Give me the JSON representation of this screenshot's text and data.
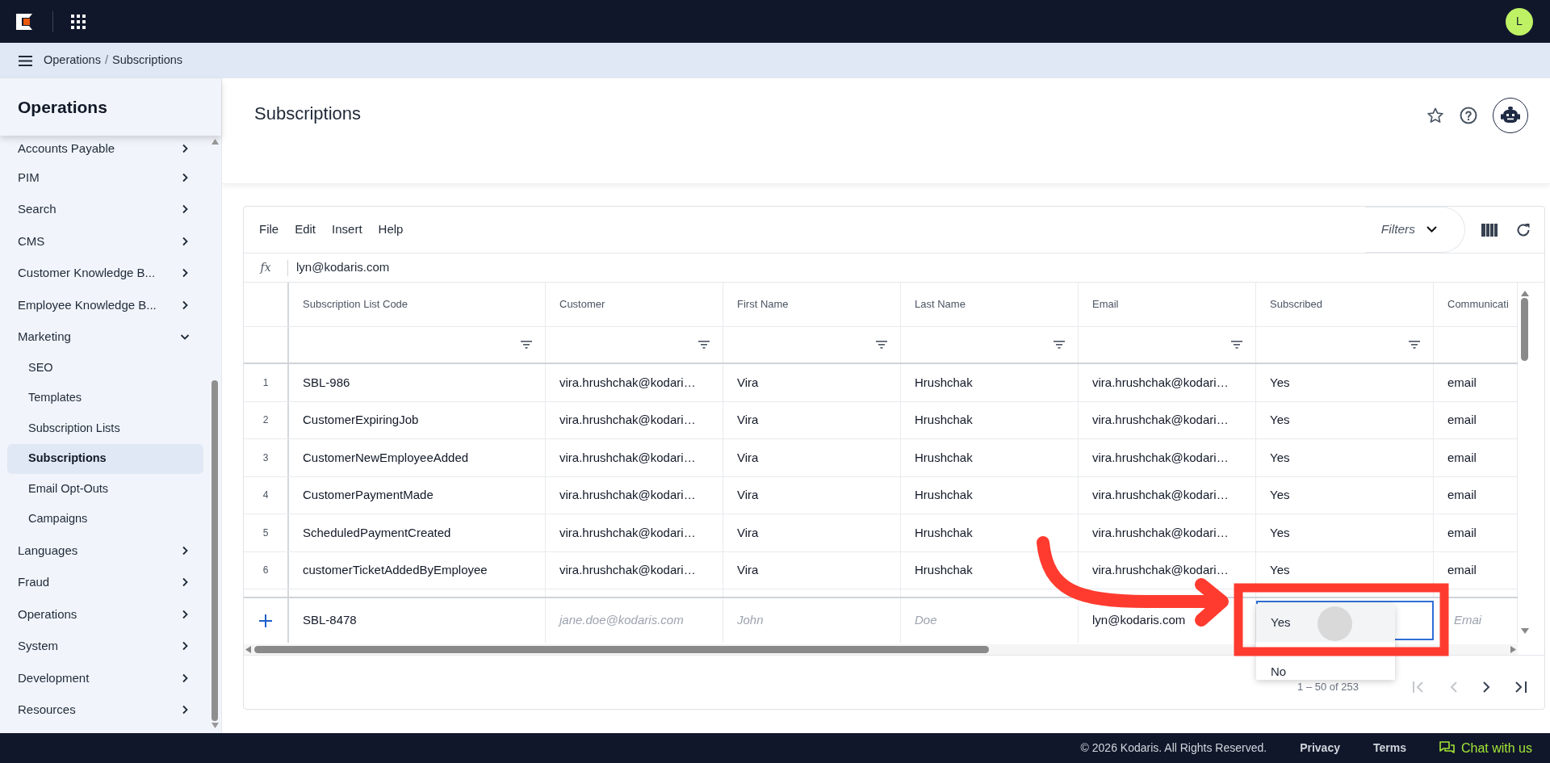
{
  "topbar": {
    "avatar": "L"
  },
  "breadcrumb": {
    "separator": "/",
    "items": [
      "Operations",
      "Subscriptions"
    ]
  },
  "sidebar": {
    "title": "Operations",
    "items": [
      {
        "label": "Accounts Payable",
        "expanded": false
      },
      {
        "label": "PIM",
        "expanded": false
      },
      {
        "label": "Search",
        "expanded": false
      },
      {
        "label": "CMS",
        "expanded": false
      },
      {
        "label": "Customer Knowledge B...",
        "expanded": false
      },
      {
        "label": "Employee Knowledge B...",
        "expanded": false
      },
      {
        "label": "Marketing",
        "expanded": true,
        "children": [
          {
            "label": "SEO",
            "selected": false
          },
          {
            "label": "Templates",
            "selected": false
          },
          {
            "label": "Subscription Lists",
            "selected": false
          },
          {
            "label": "Subscriptions",
            "selected": true
          },
          {
            "label": "Email Opt-Outs",
            "selected": false
          },
          {
            "label": "Campaigns",
            "selected": false
          }
        ]
      },
      {
        "label": "Languages",
        "expanded": false
      },
      {
        "label": "Fraud",
        "expanded": false
      },
      {
        "label": "Operations",
        "expanded": false
      },
      {
        "label": "System",
        "expanded": false
      },
      {
        "label": "Development",
        "expanded": false
      },
      {
        "label": "Resources",
        "expanded": false
      }
    ]
  },
  "page": {
    "title": "Subscriptions"
  },
  "table": {
    "menu": [
      "File",
      "Edit",
      "Insert",
      "Help"
    ],
    "filters_label": "Filters",
    "formula_mark": "fx",
    "formula": "lyn@kodaris.com",
    "columns": [
      {
        "label": "Subscription List Code",
        "filterable": true
      },
      {
        "label": "Customer",
        "filterable": true
      },
      {
        "label": "First Name",
        "filterable": true
      },
      {
        "label": "Last Name",
        "filterable": true
      },
      {
        "label": "Email",
        "filterable": true
      },
      {
        "label": "Subscribed",
        "filterable": true
      },
      {
        "label": "Communicati",
        "filterable": false
      }
    ],
    "rows": [
      {
        "number": "1",
        "cells": [
          "SBL-986",
          "vira.hrushchak@kodari…",
          "Vira",
          "Hrushchak",
          "vira.hrushchak@kodari…",
          "Yes",
          "email"
        ]
      },
      {
        "number": "2",
        "cells": [
          "CustomerExpiringJob",
          "vira.hrushchak@kodari…",
          "Vira",
          "Hrushchak",
          "vira.hrushchak@kodari…",
          "Yes",
          "email"
        ]
      },
      {
        "number": "3",
        "cells": [
          "CustomerNewEmployeeAdded",
          "vira.hrushchak@kodari…",
          "Vira",
          "Hrushchak",
          "vira.hrushchak@kodari…",
          "Yes",
          "email"
        ]
      },
      {
        "number": "4",
        "cells": [
          "CustomerPaymentMade",
          "vira.hrushchak@kodari…",
          "Vira",
          "Hrushchak",
          "vira.hrushchak@kodari…",
          "Yes",
          "email"
        ]
      },
      {
        "number": "5",
        "cells": [
          "ScheduledPaymentCreated",
          "vira.hrushchak@kodari…",
          "Vira",
          "Hrushchak",
          "vira.hrushchak@kodari…",
          "Yes",
          "email"
        ]
      },
      {
        "number": "6",
        "cells": [
          "customerTicketAddedByEmployee",
          "vira.hrushchak@kodari…",
          "Vira",
          "Hrushchak",
          "vira.hrushchak@kodari…",
          "Yes",
          "email"
        ]
      }
    ],
    "new_row": {
      "cells": [
        {
          "kind": "value",
          "text": "SBL-8478"
        },
        {
          "kind": "placeholder",
          "text": "jane.doe@kodaris.com"
        },
        {
          "kind": "placeholder",
          "text": "John"
        },
        {
          "kind": "placeholder",
          "text": "Doe"
        },
        {
          "kind": "value",
          "text": "lyn@kodaris.com"
        },
        {
          "kind": "editor"
        },
        {
          "kind": "placeholder",
          "text": "Emai"
        }
      ]
    },
    "dropdown": {
      "options": [
        {
          "label": "Yes",
          "selected": true
        },
        {
          "label": "No",
          "selected": false
        }
      ]
    },
    "pagination": "1 – 50 of 253"
  },
  "footer": {
    "copyright": "© 2026 Kodaris. All Rights Reserved.",
    "links": [
      "Privacy",
      "Terms"
    ],
    "chat": "Chat with us"
  }
}
